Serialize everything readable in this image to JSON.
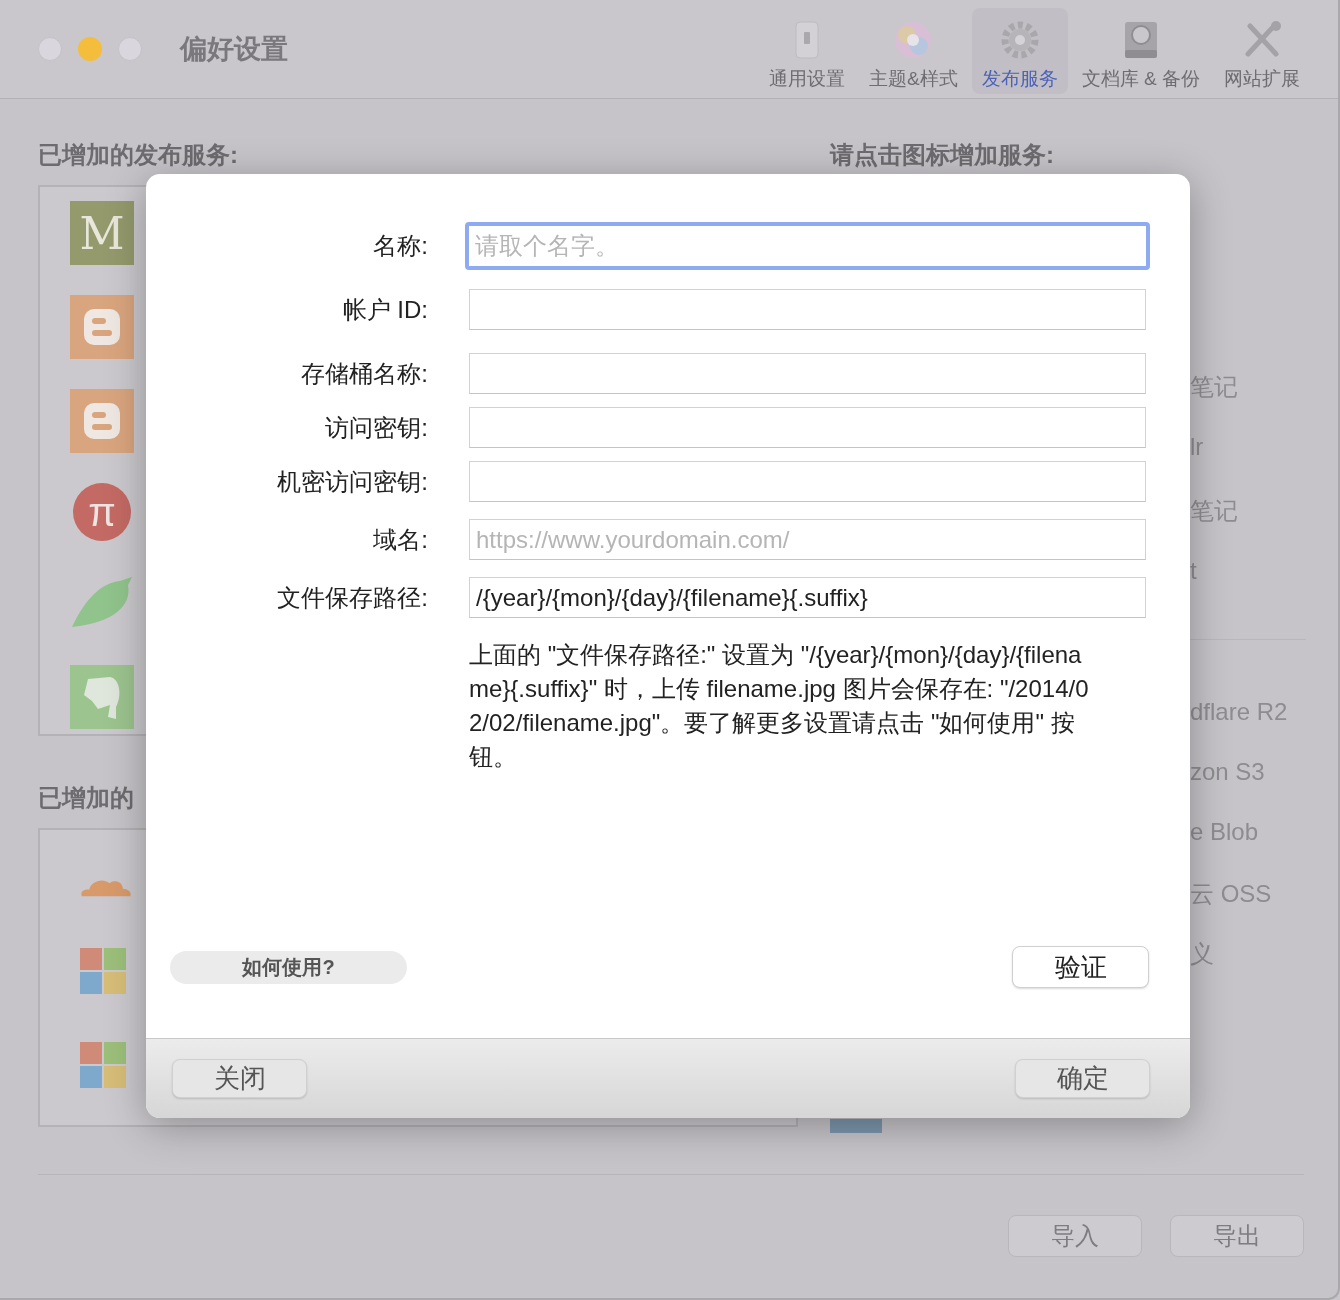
{
  "window": {
    "title": "偏好设置"
  },
  "toolbar": [
    {
      "label": "通用设置",
      "selected": false
    },
    {
      "label": "主题&样式",
      "selected": false
    },
    {
      "label": "发布服务",
      "selected": true
    },
    {
      "label": "文档库 & 备份",
      "selected": false
    },
    {
      "label": "网站扩展",
      "selected": false
    }
  ],
  "added_services": {
    "label": "已增加的发布服务:",
    "icons": [
      {
        "kind": "letter",
        "glyph": "M"
      },
      {
        "kind": "blogger"
      },
      {
        "kind": "blogger"
      },
      {
        "kind": "circle",
        "glyph": "π"
      },
      {
        "kind": "bird"
      },
      {
        "kind": "elephant"
      }
    ]
  },
  "added_storage": {
    "label": "已增加的",
    "icons": [
      {
        "kind": "cloud"
      },
      {
        "kind": "windows"
      },
      {
        "kind": "windows"
      }
    ]
  },
  "add_services": {
    "label": "请点击图标增加服务:",
    "items": [
      "笔记",
      "lr",
      "笔记",
      "t"
    ]
  },
  "add_storage": {
    "items": [
      "dflare R2",
      "zon S3",
      "e Blob",
      "云 OSS",
      "义"
    ]
  },
  "footer_buttons": [
    "导入",
    "导出"
  ],
  "dialog": {
    "fields": [
      {
        "label": "名称:",
        "placeholder": "请取个名字。",
        "focused": true
      },
      {
        "label": "帐户 ID:",
        "focused": false
      },
      {
        "label": "存储桶名称:",
        "focused": false
      },
      {
        "label": "访问密钥:",
        "focused": false
      },
      {
        "label": "机密访问密钥:",
        "focused": false
      },
      {
        "label": "域名:",
        "placeholder": "https://www.yourdomain.com/",
        "focused": false
      },
      {
        "label": "文件保存路径:",
        "value": "/{year}/{mon}/{day}/{filename}{.suffix}",
        "focused": false
      }
    ],
    "help": "上面的 \"文件保存路径:\" 设置为 \"/{year}/{mon}/{day}/{filename}{.suffix}\" 时，上传 filename.jpg 图片会保存在: \"/2014/02/02/filename.jpg\"。要了解更多设置请点击 \"如何使用\" 按钮。",
    "how_to": "如何使用?",
    "verify": "验证",
    "close": "关闭",
    "ok": "确定"
  }
}
